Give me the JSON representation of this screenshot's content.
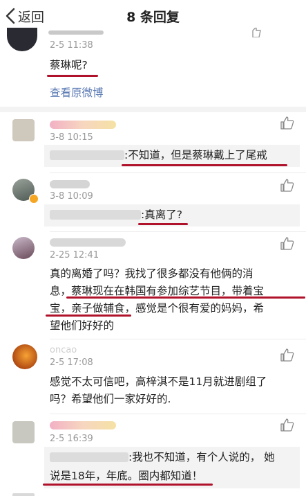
{
  "header": {
    "back_label": "返回",
    "title": "8 条回复"
  },
  "original": {
    "time": "2-5 11:38",
    "text": "蔡琳呢?",
    "view_link": "查看原微博"
  },
  "comments": [
    {
      "time": "3-8 10:15",
      "reply": ":不知道，但是蔡琳戴上了尾戒"
    },
    {
      "time": "3-8 10:09",
      "reply": ":真离了?"
    },
    {
      "time": "2-25 12:41",
      "line1": "真的离婚了吗？我找了很多都没有他俩的消",
      "line2": "息，蔡琳现在在韩国有参加综艺节目，带着宝",
      "line3": "宝，亲子做辅食，感觉是个很有爱的妈妈，希",
      "line4": "望他们好好的"
    },
    {
      "name": "oncao",
      "time": "2-5 17:08",
      "line1": "感觉不太可信吧，高梓淇不是11月就进剧组了",
      "line2": "吗？希望他们一家好好的."
    },
    {
      "time": "2-5 16:39",
      "line1": ":我也不知道，有个人说的， 她",
      "line2": "说是18年，年底。圈内都知道！"
    }
  ],
  "colors": {
    "accent_link": "#5b7bb4",
    "annotation_red": "#b0122b",
    "muted": "#999999"
  },
  "icons": [
    "chevron-left-icon",
    "thumbs-up-icon"
  ]
}
